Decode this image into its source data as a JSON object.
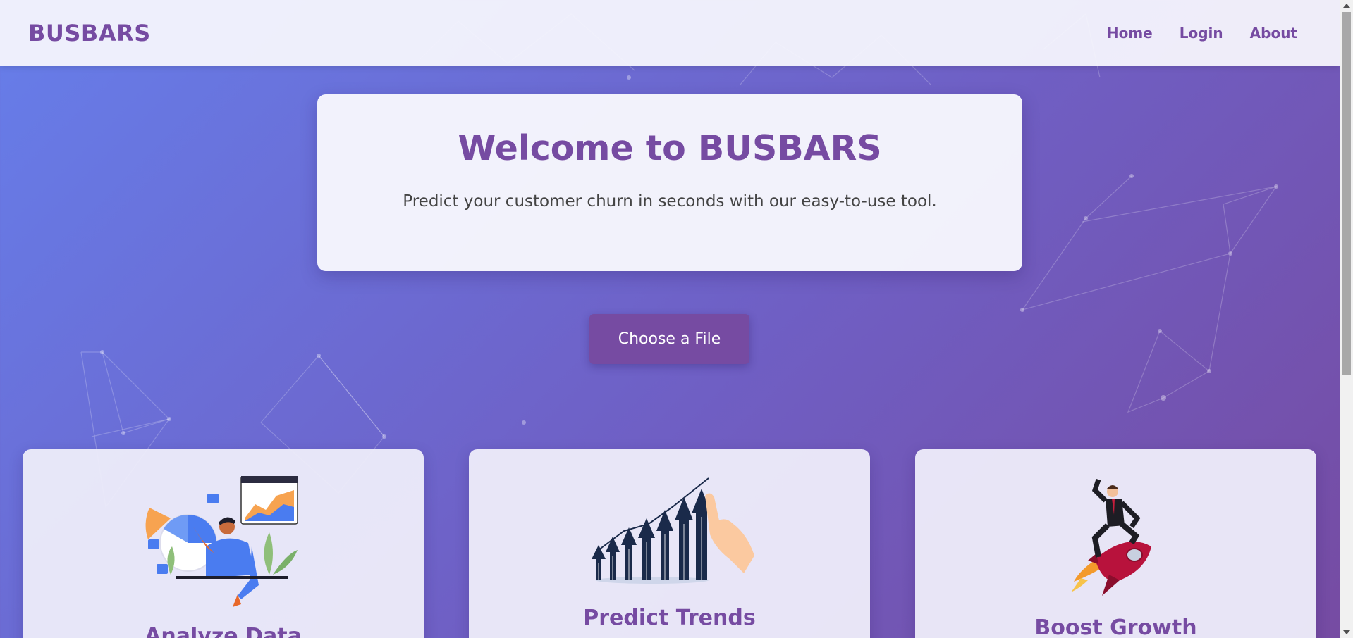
{
  "navbar": {
    "brand": "BUSBARS",
    "links": [
      "Home",
      "Login",
      "About"
    ]
  },
  "hero": {
    "title": "Welcome to BUSBARS",
    "subtitle": "Predict your customer churn in seconds with our easy-to-use tool."
  },
  "upload": {
    "label": "Choose a File"
  },
  "cards": [
    {
      "title": "Analyze Data",
      "icon": "analytics-illustration"
    },
    {
      "title": "Predict Trends",
      "icon": "rising-arrows-illustration"
    },
    {
      "title": "Boost Growth",
      "icon": "rocket-businessman-illustration"
    }
  ],
  "colors": {
    "accent": "#764ba2",
    "bg_start": "#667eea",
    "bg_end": "#764ba2"
  }
}
